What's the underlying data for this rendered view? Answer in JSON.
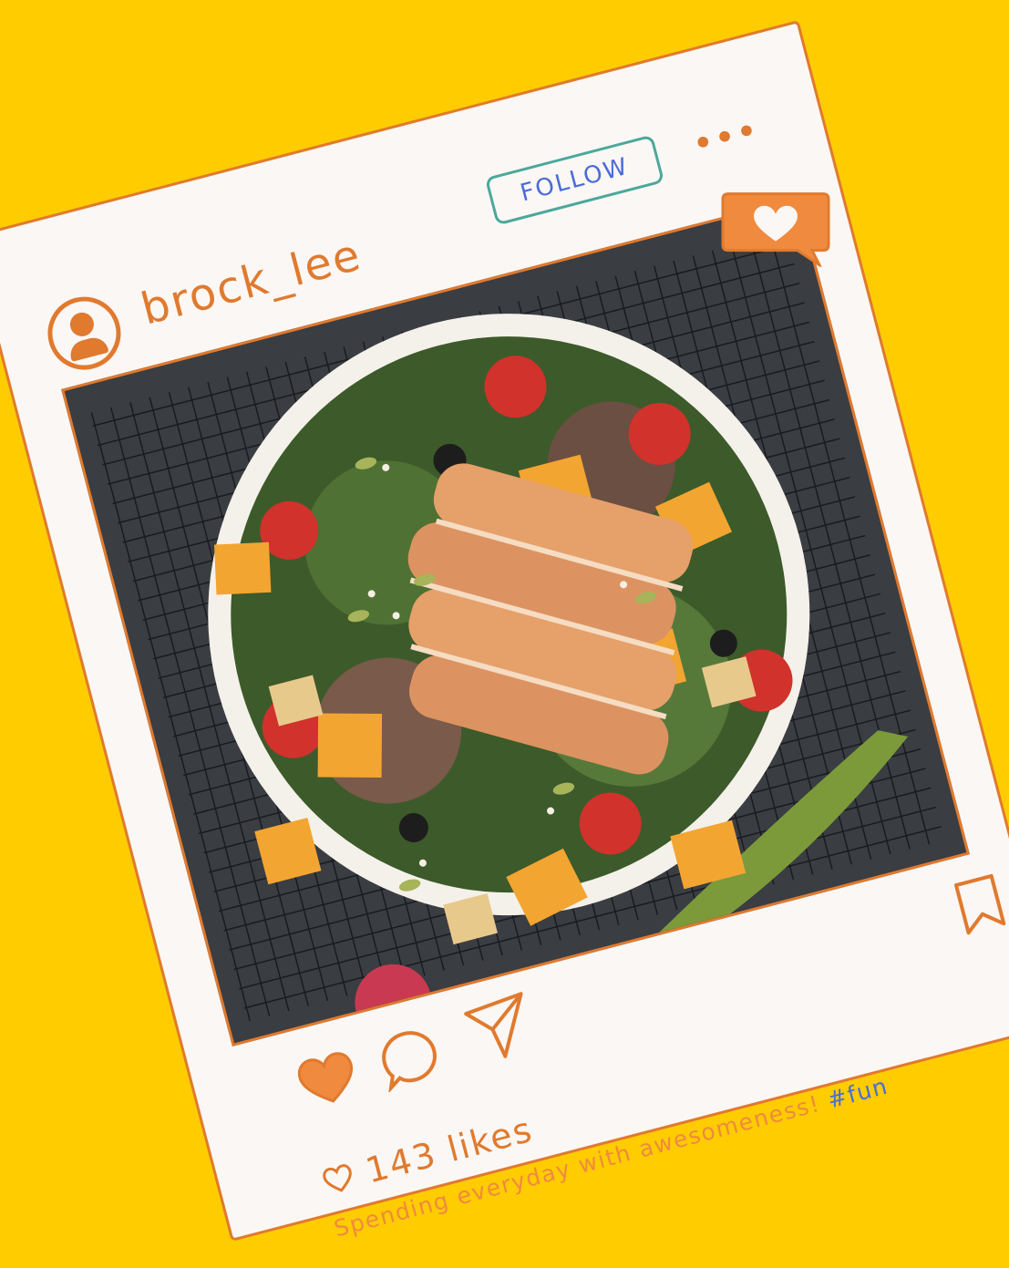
{
  "post": {
    "username": "brock_lee",
    "follow_label": "FOLLOW",
    "more_label": "•••",
    "likes": "143 likes",
    "caption_text": "Spending everyday with awesomeness! ",
    "hashtag": "#fun"
  },
  "icons": {
    "avatar": "user-avatar-icon",
    "notification": "heart-notification-icon",
    "like": "heart-icon",
    "comment": "comment-icon",
    "share": "send-icon",
    "save": "bookmark-icon",
    "likes_small": "heart-outline-icon"
  },
  "colors": {
    "background": "#FFCC00",
    "accent": "#E07A2E",
    "follow_border": "#4BA89B",
    "link": "#4A6CD9",
    "card": "#FBF7F5"
  }
}
